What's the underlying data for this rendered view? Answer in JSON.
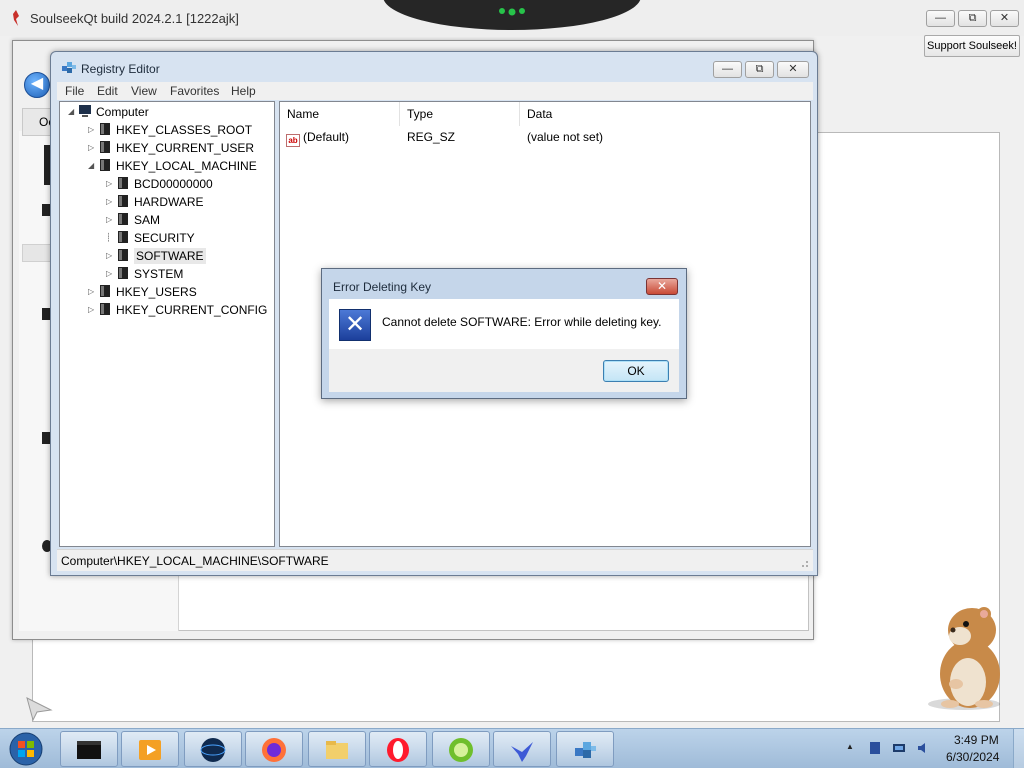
{
  "soulseek": {
    "title": "SoulseekQt build 2024.2.1 [1222ajk]",
    "support_button": "Support Soulseek!",
    "min_glyph": "—",
    "max_glyph": "⧉",
    "close_glyph": "✕",
    "tab_label": "Oc"
  },
  "regedit": {
    "title": "Registry Editor",
    "menu": [
      "File",
      "Edit",
      "View",
      "Favorites",
      "Help"
    ],
    "tree": {
      "root": "Computer",
      "hives": [
        "HKEY_CLASSES_ROOT",
        "HKEY_CURRENT_USER",
        "HKEY_LOCAL_MACHINE",
        "HKEY_USERS",
        "HKEY_CURRENT_CONFIG"
      ],
      "hklm_children": [
        "BCD00000000",
        "HARDWARE",
        "SAM",
        "SECURITY",
        "SOFTWARE",
        "SYSTEM"
      ],
      "selected": "SOFTWARE"
    },
    "columns": [
      "Name",
      "Type",
      "Data"
    ],
    "values": [
      {
        "name": "(Default)",
        "type": "REG_SZ",
        "data": "(value not set)"
      }
    ],
    "status_path": "Computer\\HKEY_LOCAL_MACHINE\\SOFTWARE"
  },
  "dialog": {
    "title": "Error Deleting Key",
    "message": "Cannot delete SOFTWARE:  Error while deleting key.",
    "ok_label": "OK",
    "close_glyph": "✕",
    "icon": "error-x-icon"
  },
  "taskbar": {
    "pinned": [
      "terminal",
      "media-player",
      "globe-app",
      "firefox",
      "file-explorer",
      "opera",
      "lime-app",
      "bird-app",
      "cube-app"
    ],
    "clock_time": "3:49 PM",
    "clock_date": "6/30/2024"
  },
  "colors": {
    "titlebar_blue": "#d7e3f1",
    "dialog_frame": "#c5d6ea",
    "taskbar": "#bcd3ea",
    "close_red": "#c94a36"
  }
}
